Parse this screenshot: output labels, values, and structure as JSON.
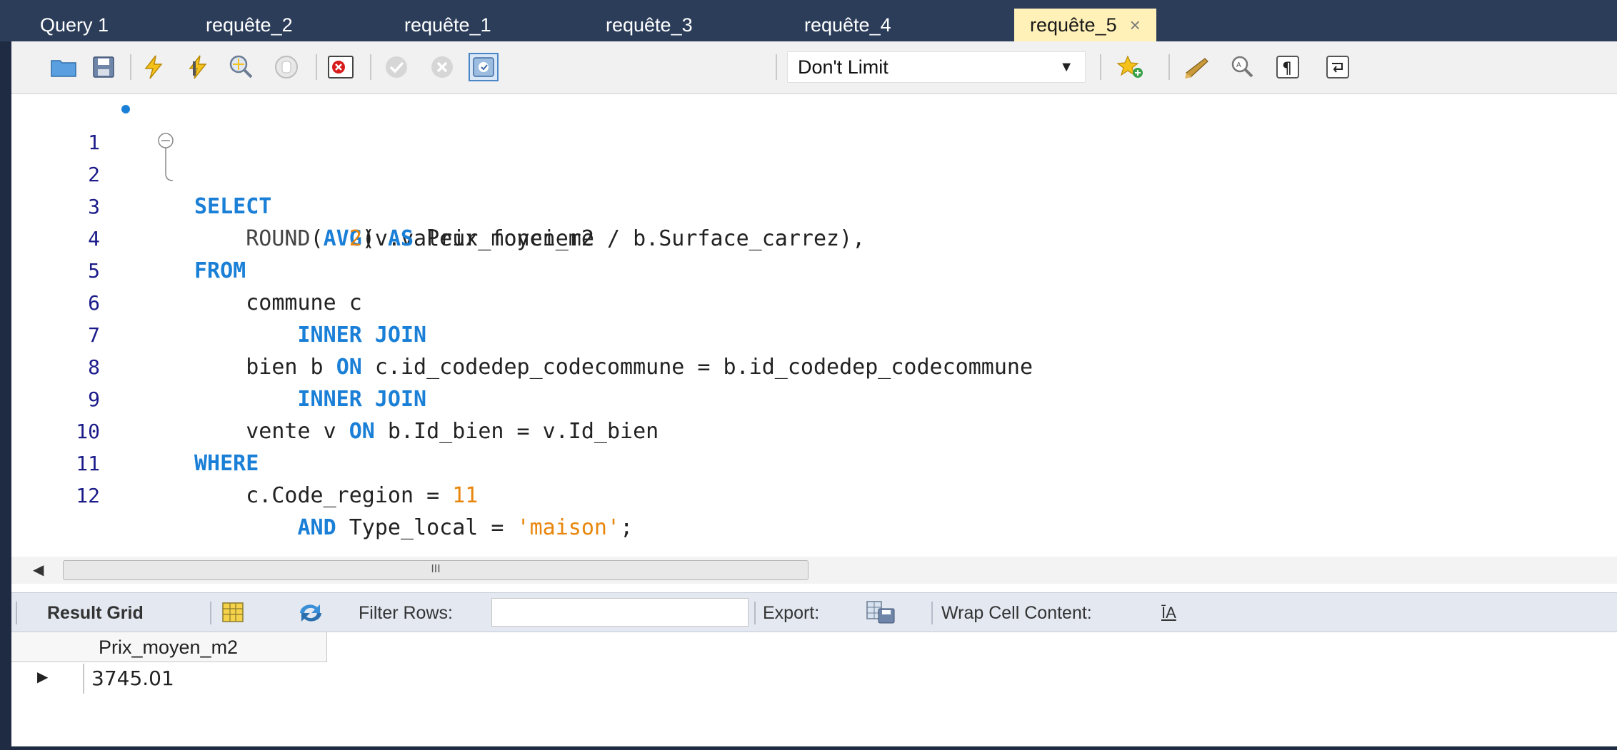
{
  "tabs": [
    {
      "label": "Query 1",
      "active": false
    },
    {
      "label": "requête_2",
      "active": false
    },
    {
      "label": "requête_1",
      "active": false
    },
    {
      "label": "requête_3",
      "active": false
    },
    {
      "label": "requête_4",
      "active": false
    },
    {
      "label": "requête_5",
      "active": true
    }
  ],
  "tab_close_glyph": "×",
  "toolbar": {
    "icons": [
      "folder-open-icon",
      "save-icon",
      "execute-icon",
      "execute-current-icon",
      "explain-icon",
      "stop-icon",
      "toggle-error-icon",
      "commit-icon",
      "rollback-icon",
      "autocommit-icon",
      "add-snippet-icon",
      "beautify-icon",
      "find-icon",
      "invisible-chars-icon",
      "wrap-lines-icon"
    ],
    "limit_value": "Don't Limit"
  },
  "editor": {
    "lines": [
      {
        "n": "1",
        "tokens": [
          {
            "t": "SELECT",
            "c": "kw"
          }
        ]
      },
      {
        "n": "2",
        "tokens": [
          {
            "t": "    ROUND",
            "c": "fn"
          },
          {
            "t": "(",
            "c": ""
          },
          {
            "t": "AVG",
            "c": "kw"
          },
          {
            "t": "(v.valeur_fonciere / b.Surface_carrez),",
            "c": ""
          }
        ]
      },
      {
        "n": "3",
        "tokens": [
          {
            "t": "            ",
            "c": ""
          },
          {
            "t": "2",
            "c": "num"
          },
          {
            "t": ") ",
            "c": ""
          },
          {
            "t": "AS",
            "c": "kw"
          },
          {
            "t": " Prix_moyen_m2",
            "c": ""
          }
        ]
      },
      {
        "n": "4",
        "tokens": [
          {
            "t": "FROM",
            "c": "kw"
          }
        ]
      },
      {
        "n": "5",
        "tokens": [
          {
            "t": "    commune c",
            "c": ""
          }
        ]
      },
      {
        "n": "6",
        "tokens": [
          {
            "t": "        ",
            "c": ""
          },
          {
            "t": "INNER JOIN",
            "c": "kw"
          }
        ]
      },
      {
        "n": "7",
        "tokens": [
          {
            "t": "    bien b ",
            "c": ""
          },
          {
            "t": "ON",
            "c": "kw"
          },
          {
            "t": " c.id_codedep_codecommune = b.id_codedep_codecommune",
            "c": ""
          }
        ]
      },
      {
        "n": "8",
        "tokens": [
          {
            "t": "        ",
            "c": ""
          },
          {
            "t": "INNER JOIN",
            "c": "kw"
          }
        ]
      },
      {
        "n": "9",
        "tokens": [
          {
            "t": "    vente v ",
            "c": ""
          },
          {
            "t": "ON",
            "c": "kw"
          },
          {
            "t": " b.Id_bien = v.Id_bien",
            "c": ""
          }
        ]
      },
      {
        "n": "10",
        "tokens": [
          {
            "t": "WHERE",
            "c": "kw"
          }
        ]
      },
      {
        "n": "11",
        "tokens": [
          {
            "t": "    c.Code_region = ",
            "c": ""
          },
          {
            "t": "11",
            "c": "num"
          }
        ]
      },
      {
        "n": "12",
        "tokens": [
          {
            "t": "        ",
            "c": ""
          },
          {
            "t": "AND",
            "c": "kw"
          },
          {
            "t": " Type_local = ",
            "c": ""
          },
          {
            "t": "'maison'",
            "c": "str"
          },
          {
            "t": ";",
            "c": ""
          }
        ]
      }
    ]
  },
  "hscroll": {
    "thumb_label": "III"
  },
  "result_toolbar": {
    "result_grid_label": "Result Grid",
    "filter_label": "Filter Rows:",
    "filter_value": "",
    "export_label": "Export:",
    "wrap_label": "Wrap Cell Content:",
    "wrap_icon_glyph": "ĪA"
  },
  "grid": {
    "columns": [
      "Prix_moyen_m2"
    ],
    "rows": [
      [
        "3745.01"
      ]
    ],
    "row_pointer_glyph": "▶"
  },
  "colors": {
    "keyword": "#1a7fd6",
    "number": "#e8860c",
    "active_tab": "#fff1b8",
    "tabbar": "#2c3d5a"
  }
}
